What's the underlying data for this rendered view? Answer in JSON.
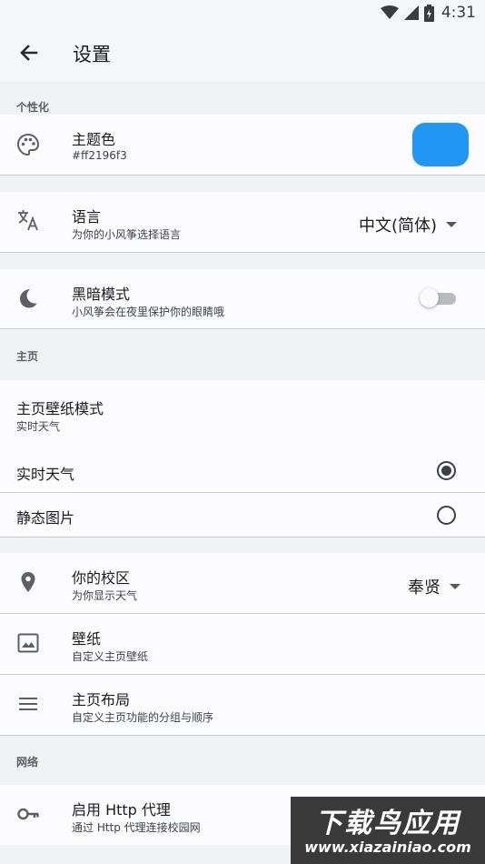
{
  "status_bar": {
    "time": "4:31",
    "icons": [
      "wifi-icon",
      "signal-icon",
      "battery-icon"
    ]
  },
  "app_bar": {
    "title": "设置",
    "back_icon": "arrow-back-icon"
  },
  "sections": {
    "personalization": "个性化",
    "home": "主页",
    "network": "网络"
  },
  "theme_color": {
    "title": "主题色",
    "value": "#ff2196f3",
    "swatch": "#2196f3",
    "icon": "palette-icon"
  },
  "language": {
    "title": "语言",
    "subtitle": "为你的小风筝选择语言",
    "selected": "中文(简体)",
    "icon": "translate-icon"
  },
  "dark_mode": {
    "title": "黑暗模式",
    "subtitle": "小风筝会在夜里保护你的眼睛哦",
    "enabled": false,
    "icon": "moon-icon"
  },
  "wallpaper_mode": {
    "title": "主页壁纸模式",
    "subtitle": "实时天气",
    "options": [
      {
        "label": "实时天气",
        "checked": true
      },
      {
        "label": "静态图片",
        "checked": false
      }
    ]
  },
  "campus": {
    "title": "你的校区",
    "subtitle": "为你显示天气",
    "selected": "奉贤",
    "icon": "location-pin-icon"
  },
  "wallpaper": {
    "title": "壁纸",
    "subtitle": "自定义主页壁纸",
    "icon": "image-icon"
  },
  "home_layout": {
    "title": "主页布局",
    "subtitle": "自定义主页功能的分组与顺序",
    "icon": "menu-lines-icon"
  },
  "http_proxy": {
    "title": "启用 Http 代理",
    "subtitle": "通过 Http 代理连接校园网",
    "icon": "key-icon"
  },
  "watermark": {
    "brand": "下载鸟应用",
    "url": "www.xiazainiao.com"
  }
}
